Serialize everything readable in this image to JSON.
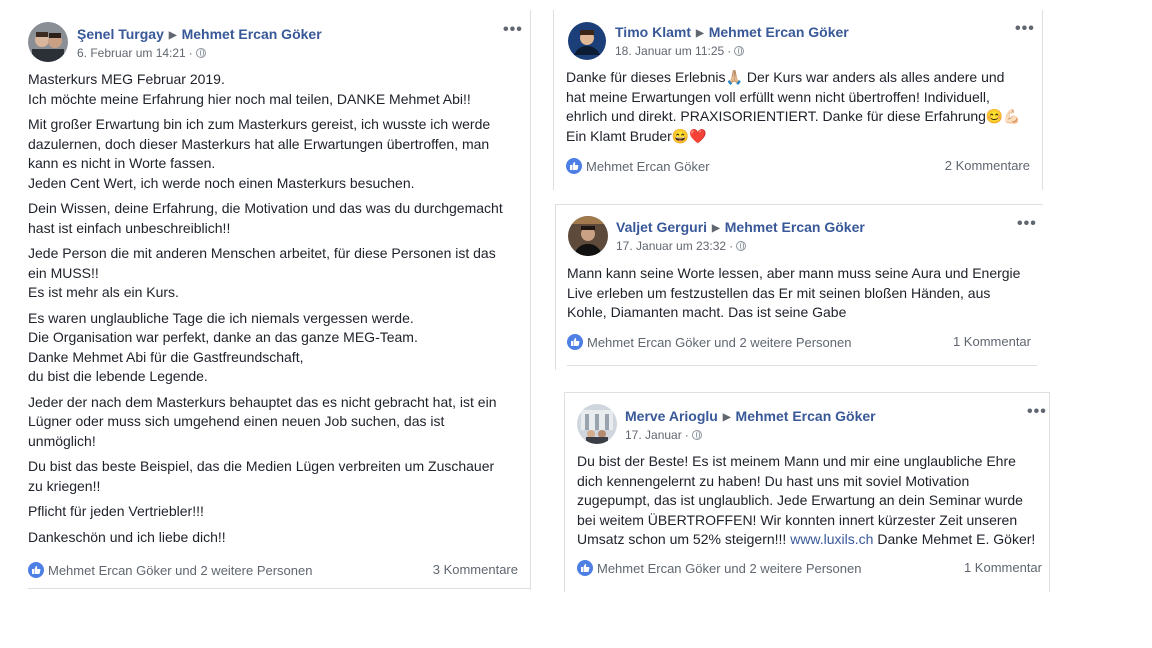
{
  "posts": [
    {
      "author": "Şenel Turgay",
      "target": "Mehmet Ercan Göker",
      "date": "6. Februar um 14:21",
      "paragraphs": [
        "Masterkurs MEG Februar 2019.\nIch möchte meine Erfahrung hier noch mal teilen, DANKE Mehmet Abi!!",
        "Mit großer Erwartung bin ich zum Masterkurs gereist, ich wusste ich werde\ndazulernen, doch dieser Masterkurs hat alle Erwartungen übertroffen, man\nkann es nicht in Worte fassen.\nJeden Cent Wert, ich werde noch einen Masterkurs besuchen.",
        "Dein Wissen, deine Erfahrung, die Motivation und das was du durchgemacht\nhast ist einfach unbeschreiblich!!",
        "Jede Person die mit anderen Menschen arbeitet, für diese Personen ist das\nein MUSS!!\nEs ist mehr als ein Kurs.",
        "Es waren unglaubliche Tage die ich niemals vergessen werde.\nDie Organisation war perfekt, danke an das ganze MEG-Team.\nDanke Mehmet Abi für die Gastfreundschaft,\ndu bist die lebende Legende.",
        "Jeder der nach dem Masterkurs behauptet das es nicht gebracht hat, ist ein\nLügner oder muss sich umgehend einen neuen Job suchen, das ist\nunmöglich!",
        "Du bist das beste Beispiel, das die Medien Lügen verbreiten um Zuschauer\nzu kriegen!!",
        "Pflicht für jeden Vertriebler!!!",
        "Dankeschön und ich liebe dich!!"
      ],
      "reactions": "Mehmet Ercan Göker und 2 weitere Personen",
      "comments": "3 Kommentare"
    },
    {
      "author": "Timo Klamt",
      "target": "Mehmet Ercan Göker",
      "date": "18. Januar um 11:25",
      "paragraphs": [
        "Danke für dieses Erlebnis🙏🏼 Der Kurs war anders als alles andere und\nhat meine Erwartungen voll erfüllt wenn nicht übertroffen! Individuell,\nehrlich und direkt. PRAXISORIENTIERT. Danke für diese Erfahrung😊💪🏻\nEin Klamt Bruder😄❤️"
      ],
      "reactions": "Mehmet Ercan Göker",
      "comments": "2 Kommentare"
    },
    {
      "author": "Valjet Gerguri",
      "target": "Mehmet Ercan Göker",
      "date": "17. Januar um 23:32",
      "paragraphs": [
        "Mann kann seine Worte lessen, aber mann muss seine Aura und Energie\nLive erleben um festzustellen das Er mit seinen bloßen Händen, aus\nKohle, Diamanten macht. Das ist seine Gabe"
      ],
      "reactions": "Mehmet Ercan Göker und 2 weitere Personen",
      "comments": "1 Kommentar"
    },
    {
      "author": "Merve Arioglu",
      "target": "Mehmet Ercan Göker",
      "date": "17. Januar",
      "text_main": "Du bist der Beste! Es ist meinem Mann und mir eine unglaubliche Ehre\ndich kennengelernt zu haben! Du hast uns mit soviel Motivation\nzugepumpt, das ist unglaublich. Jede Erwartung an dein Seminar wurde\nbei weitem ÜBERTROFFEN! Wir konnten innert kürzester Zeit unseren\nUmsatz schon um 52% steigern!!! ",
      "link": "www.luxils.ch",
      "text_after_link": " Danke Mehmet E. Göker!",
      "reactions": "Mehmet Ercan Göker und 2 weitere Personen",
      "comments": "1 Kommentar"
    }
  ],
  "ui": {
    "more": "•••",
    "arrow": "▶",
    "dot": "·"
  },
  "colors": {
    "link": "#385898",
    "like": "#4d7fe4",
    "meta": "#616770"
  },
  "icons": [
    "globe-icon",
    "like-icon",
    "more-options-icon",
    "arrow-right-icon"
  ]
}
